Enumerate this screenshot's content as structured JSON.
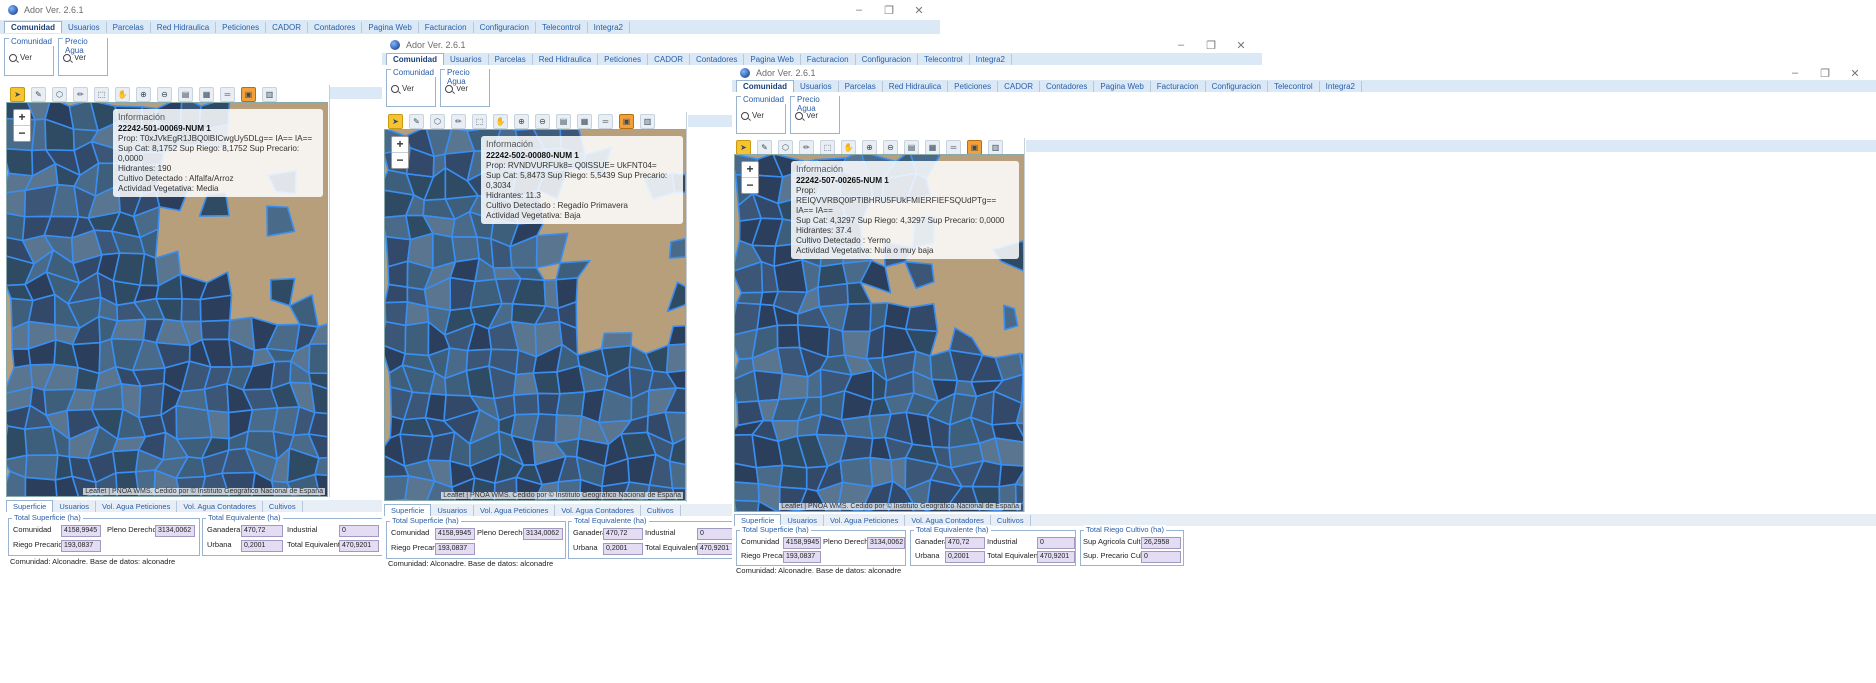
{
  "app": {
    "title": "Ador Ver. 2.6.1"
  },
  "window_controls": {
    "minimize": "–",
    "maximize": "❐",
    "close": "✕"
  },
  "menu": [
    "Comunidad",
    "Usuarios",
    "Parcelas",
    "Red Hidraulica",
    "Peticiones",
    "CADOR",
    "Contadores",
    "Pagina Web",
    "Facturacion",
    "Configuracion",
    "Telecontrol",
    "Integra2"
  ],
  "ribbon": {
    "group1": "Comunidad",
    "group2": "Precio Agua",
    "ver": "Ver"
  },
  "map": {
    "zoom_in": "+",
    "zoom_out": "−",
    "attribution": "Leaflet | PNOA WMS. Cedido por © Instituto Geográfico Nacional de España"
  },
  "info_header": "Información",
  "windows": [
    {
      "parcel": "22242-501-00069-NUM 1",
      "prop": "Prop: T0xJVkEgR1JBQ0lBICwgUy5DLg== IA== IA==",
      "sup": "Sup Cat: 8,1752 Sup Riego: 8,1752 Sup Precario: 0,0000",
      "hidrantes": "Hidrantes: 190",
      "cultivo": "Cultivo Detectado : Alfalfa/Arroz",
      "actividad": "Actividad Vegetativa: Media"
    },
    {
      "parcel": "22242-502-00080-NUM 1",
      "prop": "Prop: RVNDVURFUk8= Q0lSSUE= UkFNT04=",
      "sup": "Sup Cat: 5,8473 Sup Riego: 5,5439 Sup Precario: 0,3034",
      "hidrantes": "Hidrantes: 11.3",
      "cultivo": "Cultivo Detectado : Regadío Primavera",
      "actividad": "Actividad Vegetativa: Baja"
    },
    {
      "parcel": "22242-507-00265-NUM 1",
      "prop": "Prop: REIQVVRBQ0lPTlBHRU5FUkFMIERFIEFSQUdPTg== IA== IA==",
      "sup": "Sup Cat: 4,3297 Sup Riego: 4,3297 Sup Precario: 0,0000",
      "hidrantes": "Hidrantes: 37.4",
      "cultivo": "Cultivo Detectado : Yermo",
      "actividad": "Actividad Vegetativa: Nula o muy baja"
    }
  ],
  "bottom_tabs": [
    "Superficie",
    "Usuarios",
    "Vol. Agua Peticiones",
    "Vol. Agua Contadores",
    "Cultivos"
  ],
  "summary": {
    "total_superficie": "Total Superficie (ha)",
    "total_equivalente": "Total Equivalente (ha)",
    "total_riego_cultivo": "Total Riego Cultivo (ha)",
    "comunidad_label": "Comunidad",
    "comunidad": "4158,9945",
    "pleno_label": "Pleno Derecho",
    "pleno": "3134,0062",
    "riego_label": "Riego Precario",
    "riego": "193,0837",
    "ganadera_label": "Ganadera",
    "ganadera": "470,72",
    "industrial_label": "Industrial",
    "industrial": "0",
    "urbana_label": "Urbana",
    "urbana": "0,2001",
    "total_eq_label": "Total Equivalente",
    "total_eq": "470,9201",
    "sup_agricola_label": "Sup Agricola Cultivo",
    "sup_agricola": "26,2958",
    "sup_precario_label": "Sup. Precario Cultivo",
    "sup_precario": "0"
  },
  "status": "Comunidad: Alconadre. Base de datos: alconadre"
}
